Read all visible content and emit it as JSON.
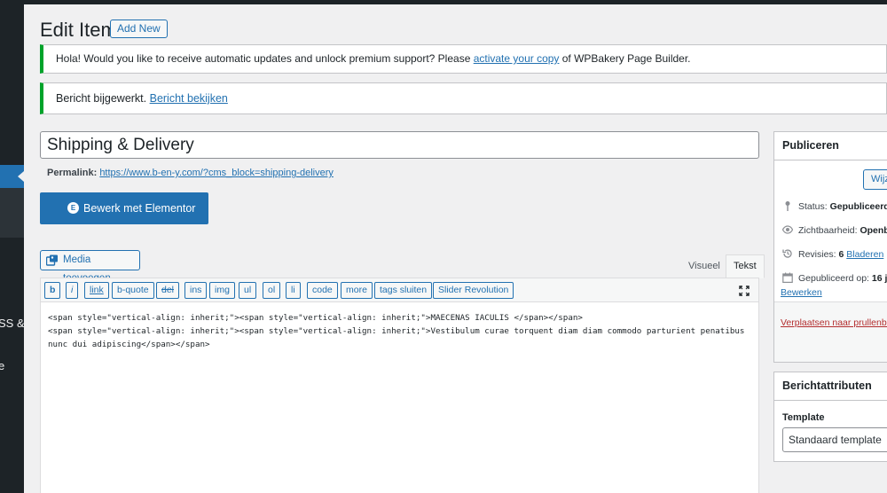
{
  "sidebar": {
    "fragments": [
      "SS &",
      "e"
    ]
  },
  "header": {
    "page_title": "Edit Item",
    "add_new_label": "Add New"
  },
  "notices": {
    "wpbakery": {
      "text_before": "Hola! Would you like to receive automatic updates and unlock premium support? Please ",
      "link": "activate your copy",
      "text_after": " of WPBakery Page Builder."
    },
    "updated": {
      "text": "Bericht bijgewerkt. ",
      "link": "Bericht bekijken"
    }
  },
  "post": {
    "title": "Shipping & Delivery",
    "permalink_label": "Permalink:",
    "permalink_url": "https://www.b-en-y.com/?cms_block=shipping-delivery"
  },
  "elementor_button": {
    "icon_text": "E",
    "label": "Bewerk met Elementor"
  },
  "editor": {
    "media_button": "Media toevoegen",
    "tabs": {
      "visual": "Visueel",
      "text": "Tekst"
    },
    "quicktags": [
      "b",
      "i",
      "link",
      "b-quote",
      "del",
      "ins",
      "img",
      "ul",
      "ol",
      "li",
      "code",
      "more",
      "tags sluiten",
      "Slider Revolution"
    ],
    "content": "<span style=\"vertical-align: inherit;\"><span style=\"vertical-align: inherit;\">MAECENAS IACULIS </span></span>\n<span style=\"vertical-align: inherit;\"><span style=\"vertical-align: inherit;\">Vestibulum curae torquent diam diam commodo parturient penatibus nunc dui adipiscing</span></span>"
  },
  "publish_box": {
    "title": "Publiceren",
    "preview_button": "Wijz",
    "status_label": "Status: ",
    "status_value": "Gepubliceerd",
    "visibility_label": "Zichtbaarheid: ",
    "visibility_value": "Openb",
    "revisions_label": "Revisies: ",
    "revisions_value": "6",
    "revisions_link": "Bladeren",
    "published_label": "Gepubliceerd op: ",
    "published_value": "16 j",
    "edit_link": "Bewerken",
    "trash_link": "Verplaatsen naar prullenba"
  },
  "attributes_box": {
    "title": "Berichtattributen",
    "template_label": "Template",
    "template_value": "Standaard template"
  },
  "colors": {
    "accent": "#2271b1",
    "success": "#00a32a",
    "danger": "#b32d2e",
    "admin_bar": "#1d2327"
  }
}
